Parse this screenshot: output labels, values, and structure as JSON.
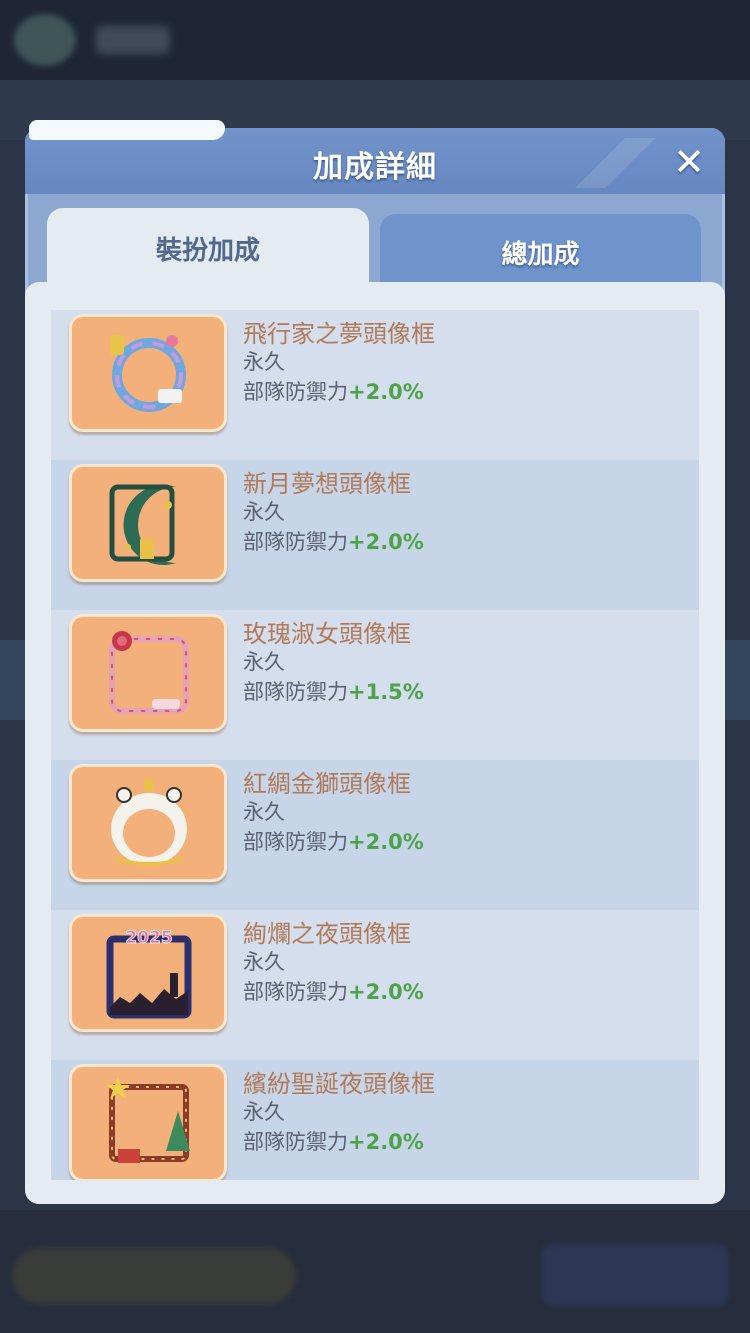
{
  "dialog": {
    "title": "加成詳細",
    "close_icon": "close-icon",
    "tabs": [
      {
        "label": "裝扮加成",
        "active": true
      },
      {
        "label": "總加成",
        "active": false
      }
    ]
  },
  "items": [
    {
      "name": "飛行家之夢頭像框",
      "duration": "永久",
      "stat_label": "部隊防禦力",
      "bonus": "+2.0%",
      "icon": "aviator-dream-frame-icon"
    },
    {
      "name": "新月夢想頭像框",
      "duration": "永久",
      "stat_label": "部隊防禦力",
      "bonus": "+2.0%",
      "icon": "crescent-dream-frame-icon"
    },
    {
      "name": "玫瑰淑女頭像框",
      "duration": "永久",
      "stat_label": "部隊防禦力",
      "bonus": "+1.5%",
      "icon": "rose-lady-frame-icon"
    },
    {
      "name": "紅綢金獅頭像框",
      "duration": "永久",
      "stat_label": "部隊防禦力",
      "bonus": "+2.0%",
      "icon": "golden-lion-frame-icon"
    },
    {
      "name": "絢爛之夜頭像框",
      "duration": "永久",
      "stat_label": "部隊防禦力",
      "bonus": "+2.0%",
      "icon": "splendid-night-frame-icon",
      "frame_text": "2025"
    },
    {
      "name": "繽紛聖誕夜頭像框",
      "duration": "永久",
      "stat_label": "部隊防禦力",
      "bonus": "+2.0%",
      "icon": "christmas-night-frame-icon"
    }
  ],
  "colors": {
    "bonus_green": "#4ca34a",
    "item_name": "#b27a58",
    "header_blue": "#6f93cb"
  }
}
